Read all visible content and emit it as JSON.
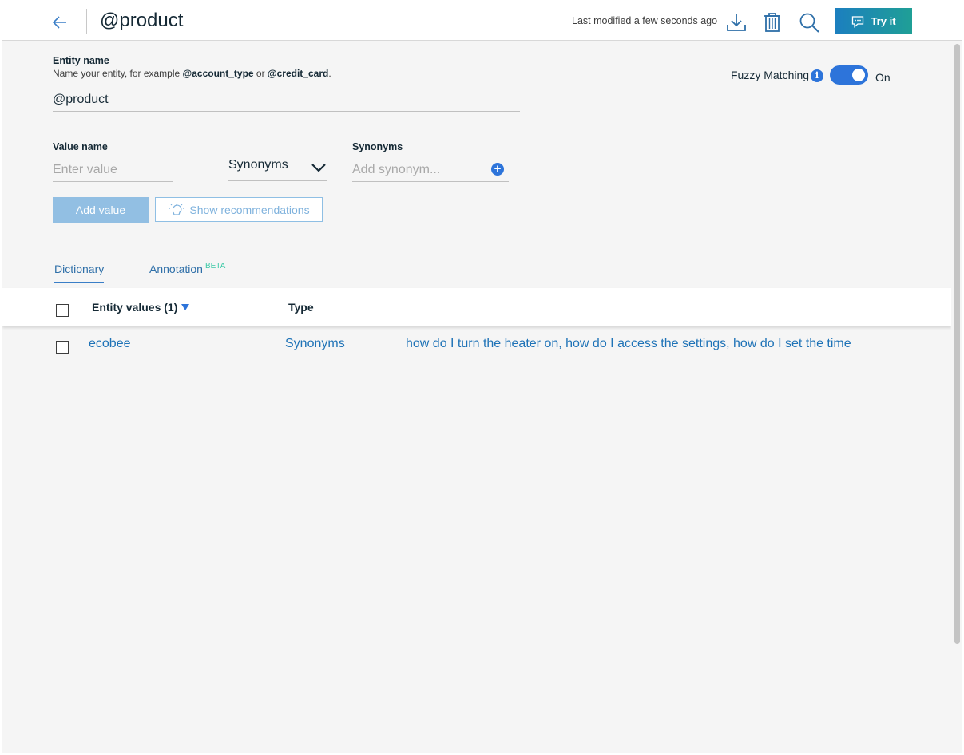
{
  "header": {
    "title": "@product",
    "last_modified": "Last modified a few seconds ago",
    "try_label": "Try it",
    "icons": [
      "back-arrow-icon",
      "download-icon",
      "trash-icon",
      "search-icon",
      "chat-bubble-icon"
    ]
  },
  "entity": {
    "label": "Entity name",
    "help_prefix": "Name your entity, for example ",
    "help_example1": "@account_type",
    "help_or": " or ",
    "help_example2": "@credit_card",
    "help_suffix": ".",
    "value": "@product"
  },
  "fuzzy": {
    "label": "Fuzzy Matching",
    "info": "i",
    "state": "On",
    "enabled": true
  },
  "value_form": {
    "value_label": "Value name",
    "value_placeholder": "Enter value",
    "type_selected": "Synonyms",
    "synonyms_label": "Synonyms",
    "synonyms_placeholder": "Add synonym...",
    "add_button": "Add value",
    "recommend_button": "Show recommendations"
  },
  "tabs": [
    {
      "label": "Dictionary",
      "active": true
    },
    {
      "label": "Annotation",
      "badge": "BETA",
      "active": false
    }
  ],
  "table": {
    "columns": [
      "Entity values (1)",
      "Type"
    ],
    "rows": [
      {
        "value": "ecobee",
        "type": "Synonyms",
        "synonyms": "how do I turn the heater on, how do I access the settings, how do I set the time"
      }
    ]
  },
  "colors": {
    "accent": "#2d74da",
    "link": "#1f73b7",
    "try_gradient_start": "#1c7fbf",
    "try_gradient_end": "#1f9f96",
    "beta": "#3bc9a6",
    "add_button_disabled": "#92bfe3"
  }
}
